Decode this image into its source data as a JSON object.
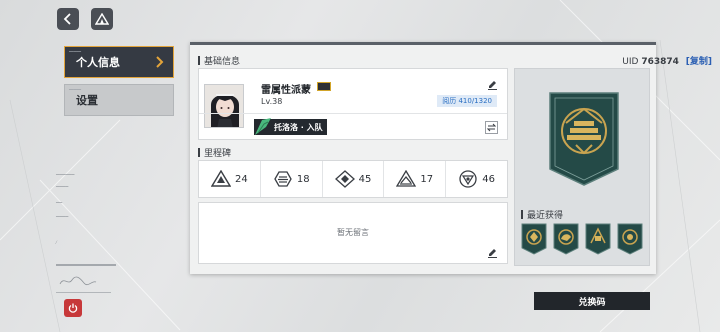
{
  "nav": {
    "personal_label": "个人信息",
    "settings_label": "设置"
  },
  "basic_info": {
    "title": "基础信息",
    "uid_label": "UID",
    "uid_value": "763874",
    "copy_label": "[复制]"
  },
  "profile": {
    "name": "雷属性派蒙",
    "level": "Lv.38",
    "activity": "阅历 410/1320",
    "assistant_label": "托洛洛 · 入队"
  },
  "milestones": {
    "title": "里程碑",
    "items": [
      {
        "icon": "triangle-emblem-icon",
        "value": "24"
      },
      {
        "icon": "striped-circle-emblem-icon",
        "value": "18"
      },
      {
        "icon": "diamond-emblem-icon",
        "value": "45"
      },
      {
        "icon": "peak-emblem-icon",
        "value": "17"
      },
      {
        "icon": "shield-circle-emblem-icon",
        "value": "46"
      }
    ]
  },
  "message": {
    "empty_text": "暂无留言"
  },
  "recent": {
    "title": "最近获得"
  },
  "redeem_label": "兑换码",
  "colors": {
    "accent": "#e3a43a",
    "panel_dark": "#353a43",
    "emblem": "#244a47",
    "gold": "#c9a450",
    "power": "#c7383a",
    "link": "#2b5fb3"
  }
}
